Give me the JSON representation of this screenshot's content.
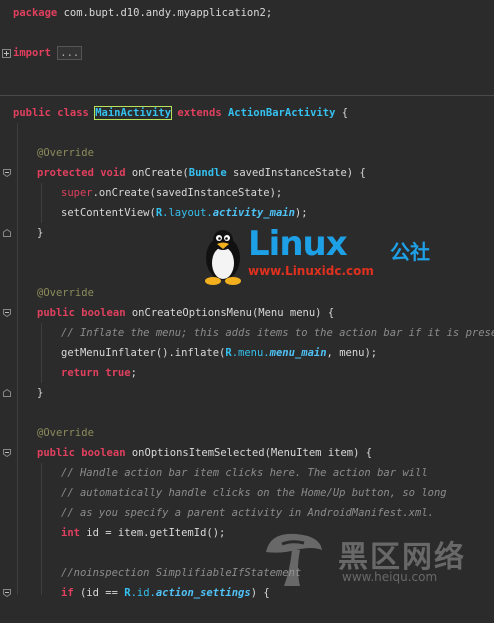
{
  "editor": {
    "lines": {
      "l1_kw": "package",
      "l1_rest": " com.bupt.d10.andy.myapplication2;",
      "l2_kw": "import",
      "l2_dots": "...",
      "l3_kw1": "public",
      "l3_kw2": "class",
      "l3_cls": "MainActivity",
      "l3_kw3": "extends",
      "l3_super": "ActionBarActivity",
      "l3_brace": " {",
      "l4_ann": "@Override",
      "l5_kw1": "protected",
      "l5_kw2": "void",
      "l5_m": " onCreate(",
      "l5_t": "Bundle",
      "l5_rest": " savedInstanceState) {",
      "l6_kw": "super",
      "l6_rest": ".onCreate(savedInstanceState);",
      "l7_a": "setContentView(",
      "l7_r": "R",
      "l7_b": ".layout.",
      "l7_f": "activity_main",
      "l7_c": ");",
      "l8_brace": "}",
      "l9_ann": "@Override",
      "l10_kw1": "public",
      "l10_kw2": "boolean",
      "l10_rest": " onCreateOptionsMenu(Menu menu) {",
      "l11_cmt": "// Inflate the menu; this adds items to the action bar if it is present.",
      "l12_a": "getMenuInflater().inflate(",
      "l12_r": "R",
      "l12_b": ".menu.",
      "l12_f": "menu_main",
      "l12_c": ", menu);",
      "l13_kw": "return",
      "l13_v": "true",
      "l13_c": ";",
      "l14_brace": "}",
      "l15_ann": "@Override",
      "l16_kw1": "public",
      "l16_kw2": "boolean",
      "l16_rest": " onOptionsItemSelected(MenuItem item) {",
      "l17_cmt": "// Handle action bar item clicks here. The action bar will",
      "l18_cmt": "// automatically handle clicks on the Home/Up button, so long",
      "l19_cmt": "// as you specify a parent activity in AndroidManifest.xml.",
      "l20_kw": "int",
      "l20_rest": " id = item.getItemId();",
      "l21_cmt": "//noinspection SimplifiableIfStatement",
      "l22_kw": "if",
      "l22_a": " (id == ",
      "l22_r": "R",
      "l22_b": ".id.",
      "l22_f": "action_settings",
      "l22_c": ") {"
    }
  },
  "watermark1": {
    "brand": "Linux",
    "cn": "公社",
    "url": "www.Linuxidc.com"
  },
  "watermark2": {
    "cn": "黑区网络",
    "url": "www.heiqu.com"
  },
  "colors": {
    "keyword": "#e0405e",
    "type": "#35c1f0",
    "comment": "#8c8c8c",
    "annotation": "#8c8c5c",
    "background": "#2b2b2b"
  }
}
